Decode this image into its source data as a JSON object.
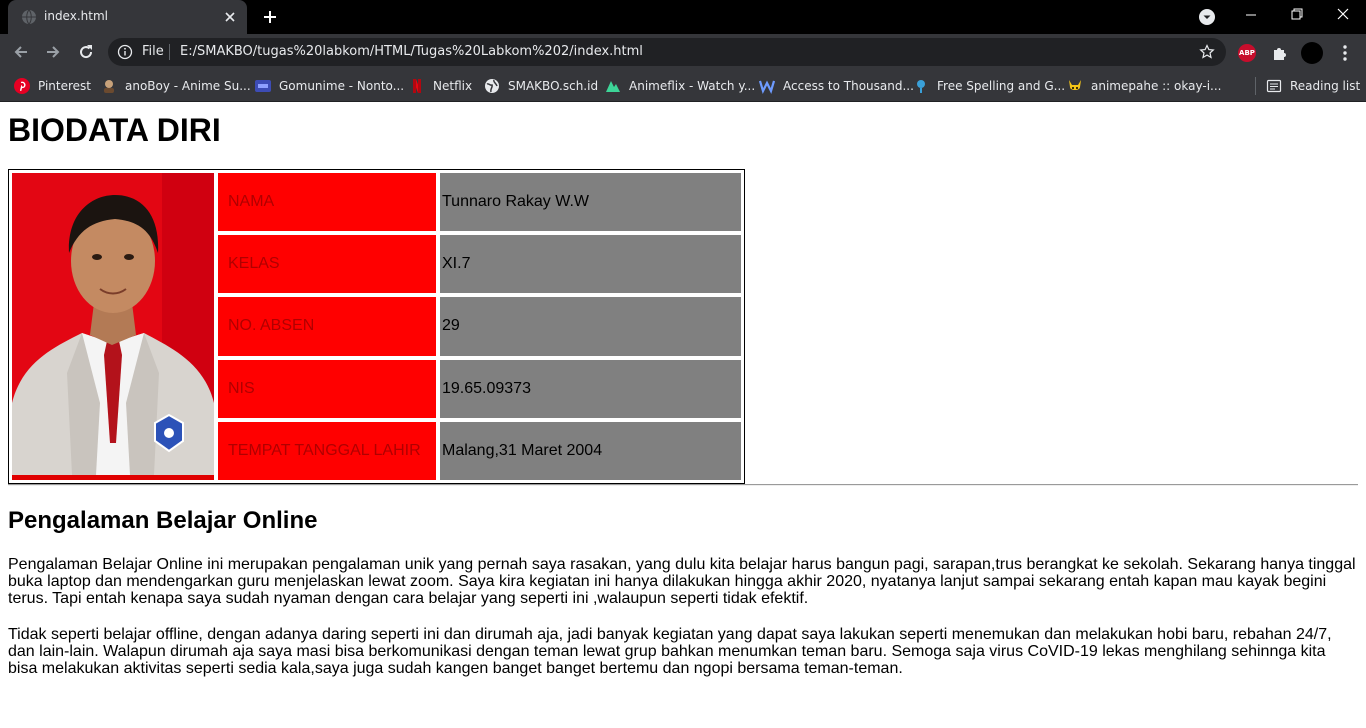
{
  "browser": {
    "tab_title": "index.html",
    "address_scheme_label": "File",
    "url": "E:/SMAKBO/tugas%20labkom/HTML/Tugas%20Labkom%202/index.html",
    "extension_abp_label": "ABP",
    "bookmarks": [
      {
        "label": "Pinterest",
        "icon": "pinterest-icon"
      },
      {
        "label": "anoBoy - Anime Su...",
        "icon": "anoboy-icon"
      },
      {
        "label": "Gomunime - Nonto...",
        "icon": "gomunime-icon"
      },
      {
        "label": "Netflix",
        "icon": "netflix-icon"
      },
      {
        "label": "SMAKBO.sch.id",
        "icon": "globe-icon"
      },
      {
        "label": "Animeflix - Watch y...",
        "icon": "animeflix-icon"
      },
      {
        "label": "Access to Thousand...",
        "icon": "w-icon"
      },
      {
        "label": "Free Spelling and G...",
        "icon": "pin-icon"
      },
      {
        "label": "animepahe :: okay-i...",
        "icon": "pikachu-icon"
      }
    ],
    "reading_list_label": "Reading list"
  },
  "page": {
    "title": "BIODATA DIRI",
    "biodata": [
      {
        "label": "NAMA",
        "value": "Tunnaro Rakay W.W"
      },
      {
        "label": "KELAS",
        "value": "XI.7"
      },
      {
        "label": "NO. ABSEN",
        "value": "29"
      },
      {
        "label": "NIS",
        "value": "19.65.09373"
      },
      {
        "label": "TEMPAT TANGGAL LAHIR",
        "value": "Malang,31 Maret 2004"
      }
    ],
    "section_title": "Pengalaman Belajar Online",
    "paragraphs": [
      "Pengalaman Belajar Online ini merupakan pengalaman unik yang pernah saya rasakan, yang dulu kita belajar harus bangun pagi, sarapan,trus berangkat ke sekolah. Sekarang hanya tinggal buka laptop dan mendengarkan guru menjelaskan lewat zoom. Saya kira kegiatan ini hanya dilakukan hingga akhir 2020, nyatanya lanjut sampai sekarang entah kapan mau kayak begini terus. Tapi entah kenapa saya sudah nyaman dengan cara belajar yang seperti ini ,walaupun seperti tidak efektif.",
      "Tidak seperti belajar offline, dengan adanya daring seperti ini dan dirumah aja, jadi banyak kegiatan yang dapat saya lakukan seperti menemukan dan melakukan hobi baru, rebahan 24/7, dan lain-lain. Walapun dirumah aja saya masi bisa berkomunikasi dengan teman lewat grup bahkan menumkan teman baru. Semoga saja virus CoVID-19 lekas menghilang sehinnga kita bisa melakukan aktivitas seperti sedia kala,saya juga sudah kangen banget banget bertemu dan ngopi bersama teman-teman."
    ]
  },
  "colors": {
    "label_bg": "#ff0000",
    "value_bg": "#808080",
    "chrome_dark": "#35363a"
  }
}
